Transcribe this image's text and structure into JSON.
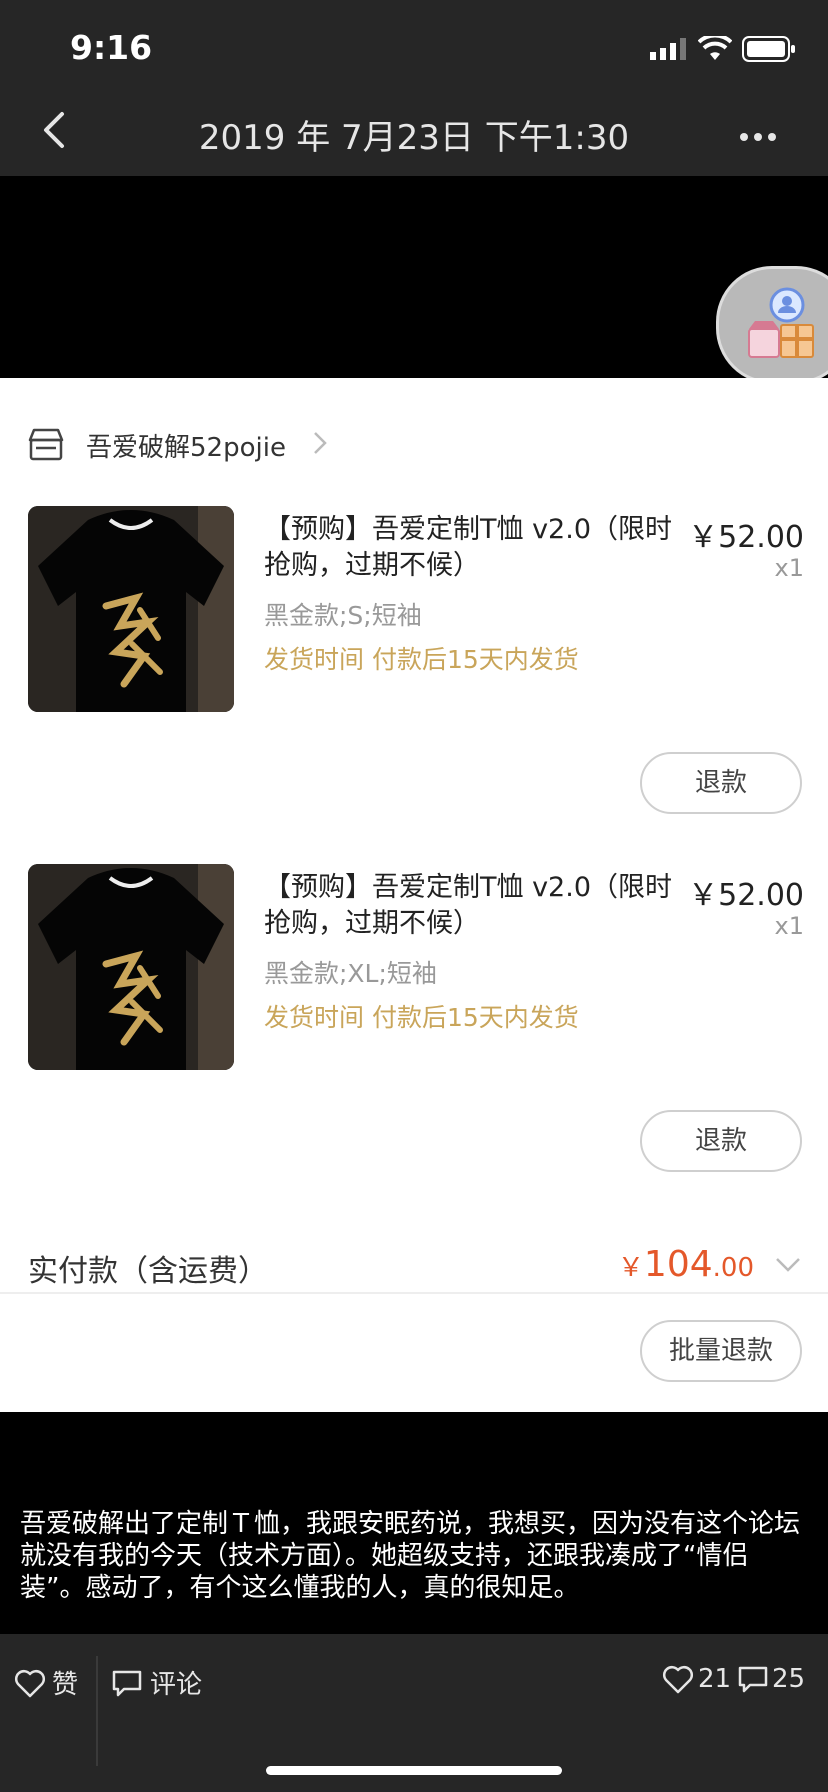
{
  "status_bar": {
    "time": "9:16"
  },
  "nav": {
    "title": "2019 年 7月23日 下午1:30"
  },
  "shop": {
    "name": "吾爱破解52pojie"
  },
  "items": [
    {
      "title": "【预购】吾爱定制T恤 v2.0（限时抢购，过期不候）",
      "price": "￥52.00",
      "qty": "x1",
      "variant": "黑金款;S;短袖",
      "shipping": "发货时间 付款后15天内发货",
      "refund_label": "退款"
    },
    {
      "title": "【预购】吾爱定制T恤 v2.0（限时抢购，过期不候）",
      "price": "￥52.00",
      "qty": "x1",
      "variant": "黑金款;XL;短袖",
      "shipping": "发货时间 付款后15天内发货",
      "refund_label": "退款"
    }
  ],
  "total": {
    "label": "实付款（含运费）",
    "currency": "￥",
    "int": "104",
    "dec": ".00"
  },
  "bulk_refund_label": "批量退款",
  "caption": "吾爱破解出了定制Ｔ恤，我跟安眠药说，我想买，因为没有这个论坛就没有我的今天（技术方面）。她超级支持，还跟我凑成了“情侣装”。感动了，有个这么懂我的人，真的很知足。",
  "bottom_bar": {
    "like_label": "赞",
    "comment_label": "评论",
    "like_count": "21",
    "comment_count": "25"
  }
}
